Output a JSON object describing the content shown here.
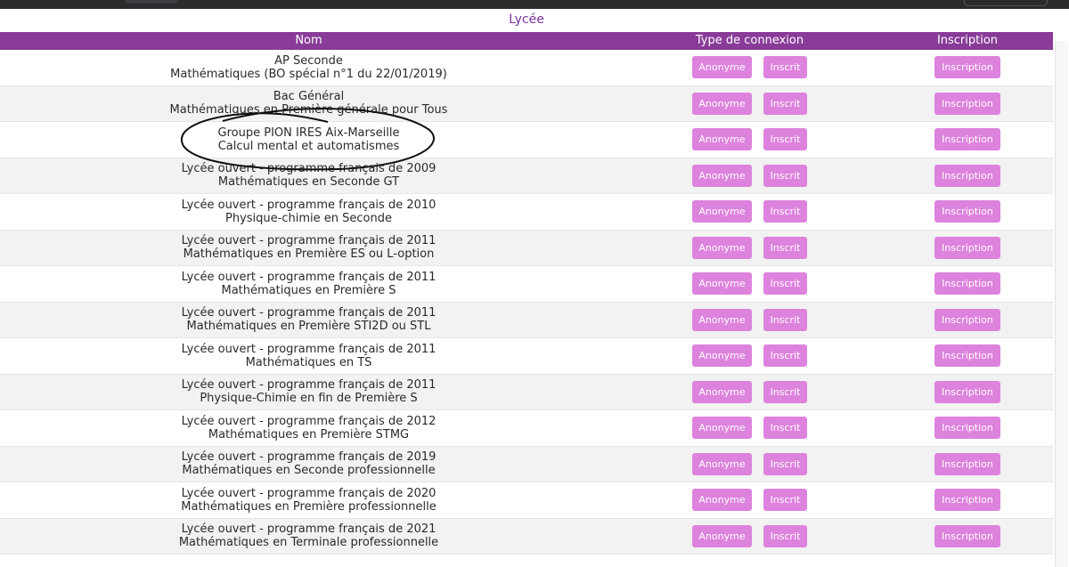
{
  "section_title": "Lycée",
  "columns": {
    "nom": "Nom",
    "type": "Type de connexion",
    "inscription": "Inscription"
  },
  "buttons": {
    "anonyme": "Anonyme",
    "inscrit": "Inscrit",
    "inscription": "Inscription"
  },
  "accent_color": "#893b98",
  "button_color": "#dd82dd",
  "rows": [
    {
      "line1": "AP Seconde",
      "line2": "Mathématiques (BO spécial n°1 du 22/01/2019)"
    },
    {
      "line1": "Bac Général",
      "line2": "Mathématiques en Première générale pour Tous"
    },
    {
      "line1": "Groupe PION IRES Aix-Marseille",
      "line2": "Calcul mental et automatismes"
    },
    {
      "line1": "Lycée ouvert - programme français de 2009",
      "line2": "Mathématiques en Seconde GT"
    },
    {
      "line1": "Lycée ouvert - programme français de 2010",
      "line2": "Physique-chimie en Seconde"
    },
    {
      "line1": "Lycée ouvert - programme français de 2011",
      "line2": "Mathématiques en Première ES ou L-option"
    },
    {
      "line1": "Lycée ouvert - programme français de 2011",
      "line2": "Mathématiques en Première S"
    },
    {
      "line1": "Lycée ouvert - programme français de 2011",
      "line2": "Mathématiques en Première STI2D ou STL"
    },
    {
      "line1": "Lycée ouvert - programme français de 2011",
      "line2": "Mathématiques en TS"
    },
    {
      "line1": "Lycée ouvert - programme français de 2011",
      "line2": "Physique-Chimie en fin de Première S"
    },
    {
      "line1": "Lycée ouvert - programme français de 2012",
      "line2": "Mathématiques en Première STMG"
    },
    {
      "line1": "Lycée ouvert - programme français de 2019",
      "line2": "Mathématiques en Seconde professionnelle"
    },
    {
      "line1": "Lycée ouvert - programme français de 2020",
      "line2": "Mathématiques en Première professionnelle"
    },
    {
      "line1": "Lycée ouvert - programme français de 2021",
      "line2": "Mathématiques en Terminale professionnelle"
    }
  ]
}
